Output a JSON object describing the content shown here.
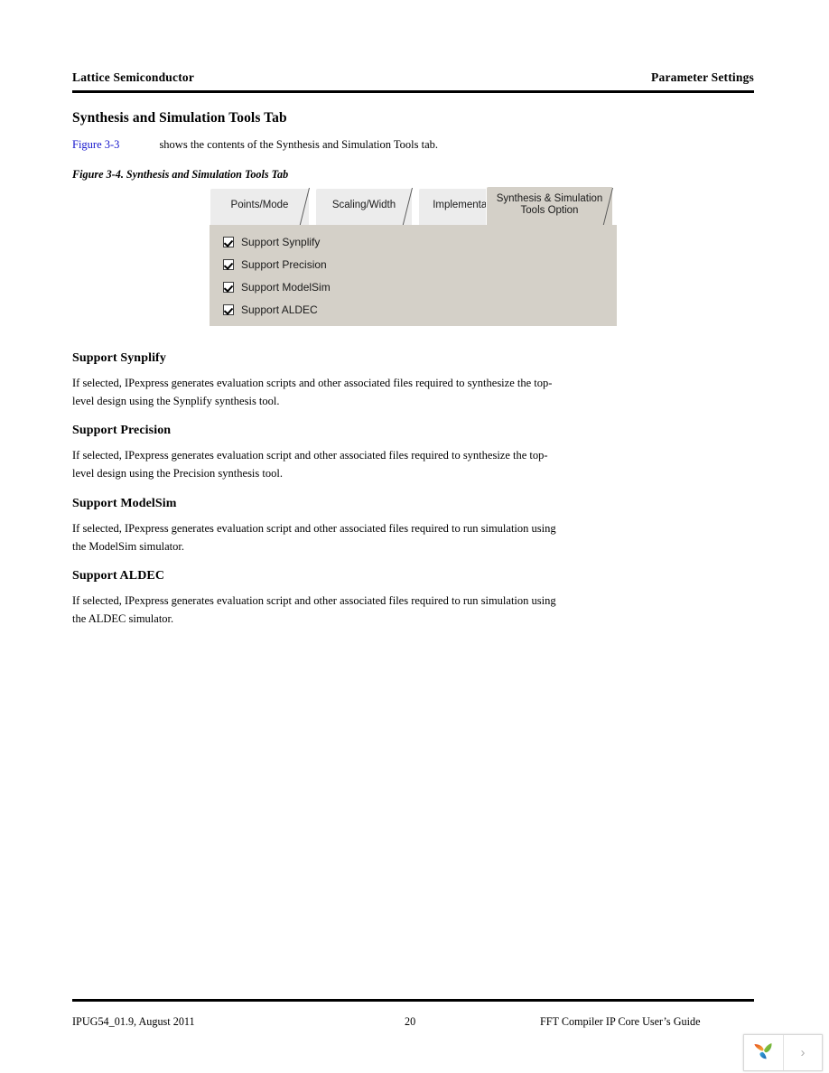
{
  "header": {
    "left": "Lattice Semiconductor",
    "right": "Parameter Settings"
  },
  "section": {
    "heading": "Synthesis and Simulation Tools Tab",
    "xref_label": "Figure 3-3",
    "xref_color": "#1414cc",
    "intro_text": "shows the contents of the Synthesis and Simulation Tools tab."
  },
  "figure": {
    "caption": "Figure 3-4. Synthesis and Simulation Tools Tab",
    "dialog": {
      "panel_color": "#d4d0c8",
      "tab_inactive_color": "#ececec",
      "tabs": [
        {
          "label": "Points/Mode",
          "active": false
        },
        {
          "label": "Scaling/Width",
          "active": false
        },
        {
          "label": "Implementation",
          "active": false
        },
        {
          "label": "Synthesis & Simulation Tools Option",
          "active": true
        }
      ],
      "checkboxes": [
        {
          "label": "Support Synplify",
          "checked": true
        },
        {
          "label": "Support Precision",
          "checked": true
        },
        {
          "label": "Support ModelSim",
          "checked": true
        },
        {
          "label": "Support ALDEC",
          "checked": true
        }
      ]
    }
  },
  "sections": [
    {
      "heading": "Support Synplify",
      "paragraph": "If selected, IPexpress generates evaluation scripts and other associated files required to synthesize the top-level design using the Synplify synthesis tool."
    },
    {
      "heading": "Support Precision",
      "paragraph": "If selected, IPexpress generates evaluation script and other associated files required to synthesize the top-level design using the Precision synthesis tool."
    },
    {
      "heading": "Support ModelSim",
      "paragraph": "If selected, IPexpress generates evaluation script and other associated files required to run simulation using the ModelSim simulator."
    },
    {
      "heading": "Support ALDEC",
      "paragraph": "If selected, IPexpress generates evaluation script and other associated files required to run simulation using the ALDEC simulator."
    }
  ],
  "footer": {
    "doc_id": "IPUG54_01.9, August 2011",
    "page_number": "20",
    "doc_title": "FFT Compiler IP Core User’s Guide"
  },
  "viewer": {
    "next_glyph": "›"
  }
}
